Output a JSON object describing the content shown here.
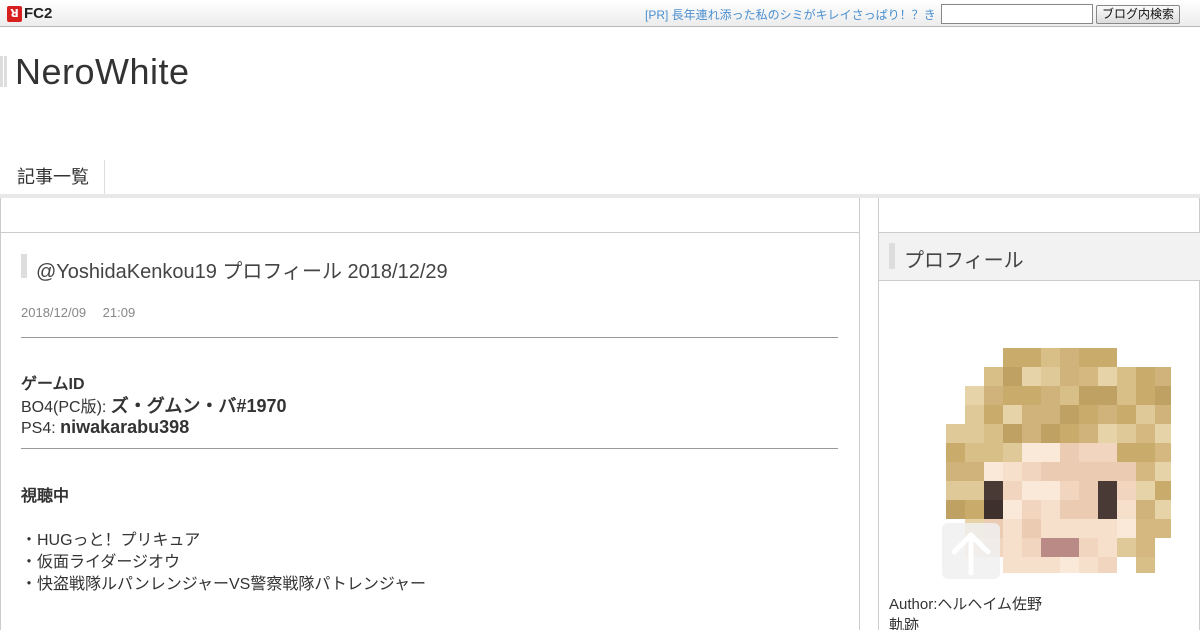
{
  "fc2": {
    "logo_mark": "ꓤ",
    "logo_text": "FC2",
    "pr_text": "[PR] 長年連れ添った私のシミがキレイさっぱり！？き",
    "search_placeholder": "",
    "search_button": "ブログ内検索"
  },
  "blog": {
    "title": "NeroWhite"
  },
  "nav": {
    "items": [
      {
        "label": "記事一覧"
      }
    ]
  },
  "post": {
    "title": "@YoshidaKenkou19 プロフィール 2018/12/29",
    "date": "2018/12/09　 21:09",
    "game_id_heading": "ゲームID",
    "bo4_label": "BO4(PC版): ",
    "bo4_value": "ズ・グムン・バ#1970",
    "ps4_label": "PS4: ",
    "ps4_value": "niwakarabu398",
    "watching_heading": "視聴中",
    "watching_items": [
      "・HUGっと！プリキュア",
      "・仮面ライダージオウ",
      "・快盗戦隊ルパンレンジャーVS警察戦隊パトレンジャー"
    ]
  },
  "sidebar": {
    "profile_heading": "プロフィール",
    "author": "Author:ヘルヘイム佐野",
    "kiseki": "軌跡"
  },
  "colors": {
    "pr_link": "#4a8fd0",
    "logo_red": "#d82020",
    "rule": "#999999"
  },
  "icons": {
    "fc2_logo": "fc2-logo-icon",
    "scroll_top": "arrow-up-icon",
    "avatar": "pixelated-avatar-image"
  }
}
